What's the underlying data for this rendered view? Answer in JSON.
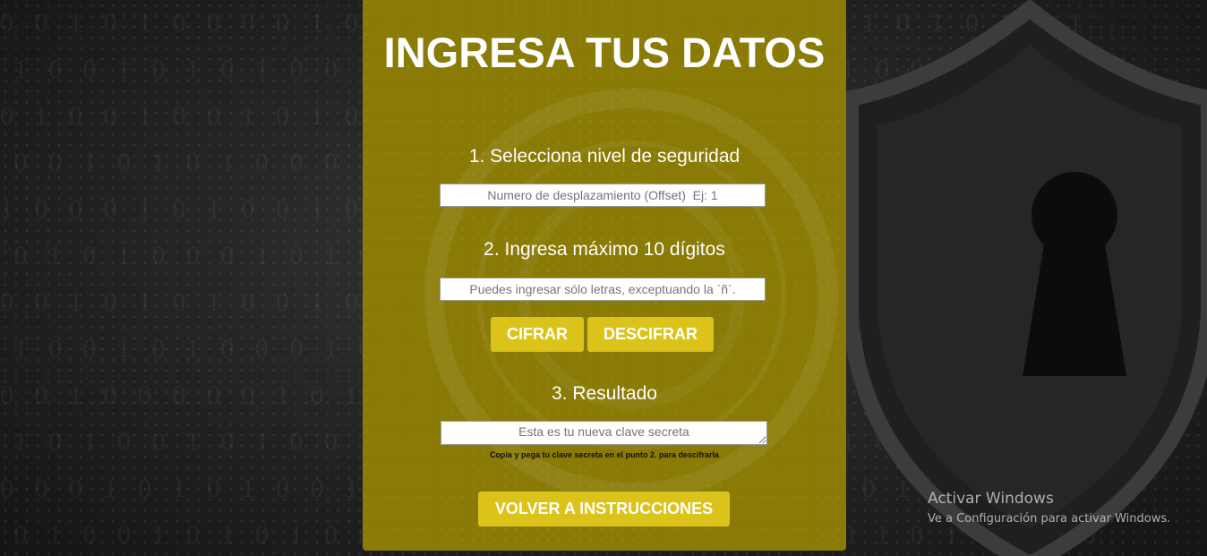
{
  "page": {
    "title": "INGRESA TUS DATOS",
    "accent_color": "#dcc31a",
    "panel_color": "#8a7a06"
  },
  "step1": {
    "label": "1. Selecciona nivel de seguridad",
    "offset_placeholder": "Numero de desplazamiento (Offset)  Ej: 1"
  },
  "step2": {
    "label": "2. Ingresa máximo 10 dígitos",
    "text_placeholder": "Puedes ingresar sólo letras, exceptuando la `ñ`."
  },
  "actions": {
    "cipher_label": "CIFRAR",
    "decipher_label": "DESCIFRAR"
  },
  "step3": {
    "label": "3. Resultado",
    "result_placeholder": "Esta es tu nueva clave secreta",
    "hint": "Copia y pega tu clave secreta en el punto 2. para descifrarla"
  },
  "footer": {
    "back_label": "VOLVER A INSTRUCCIONES"
  },
  "windows_watermark": {
    "title": "Activar Windows",
    "subtitle": "Ve a Configuración para activar Windows."
  },
  "background": {
    "decoration_icons": [
      "shield-icon",
      "keyhole-icon",
      "binary-text-pattern"
    ]
  }
}
